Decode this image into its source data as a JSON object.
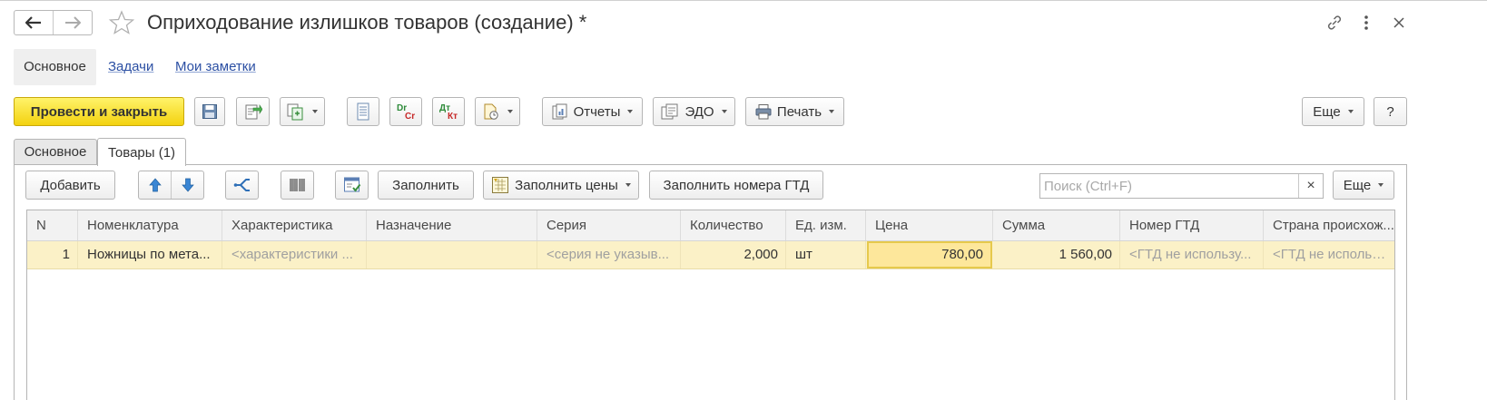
{
  "window": {
    "title": "Оприходование излишков товаров (создание) *",
    "icons": [
      "back-arrow-icon",
      "forward-arrow-icon",
      "star-icon",
      "link-icon",
      "more-vertical-icon",
      "close-icon"
    ]
  },
  "sections": {
    "main": "Основное",
    "tasks": "Задачи",
    "notes": "Мои заметки"
  },
  "toolbar": {
    "post_close": "Провести и закрыть",
    "reports": "Отчеты",
    "edo": "ЭДО",
    "print": "Печать",
    "more": "Еще",
    "help": "?",
    "icons": [
      "save-icon",
      "post-icon",
      "create-based-on-icon",
      "journal-icon",
      "dr-cr-icon",
      "dt-kt-icon",
      "attachments-icon",
      "reports-icon",
      "edo-icon",
      "printer-icon"
    ],
    "dr_top": "Dr",
    "dr_bottom": "Cr",
    "dt_top": "Дт",
    "dt_bottom": "Кт"
  },
  "tabs": {
    "main": "Основное",
    "goods": "Товары (1)"
  },
  "table_toolbar": {
    "add": "Добавить",
    "fill": "Заполнить",
    "fill_prices": "Заполнить цены",
    "fill_gtd": "Заполнить номера ГТД",
    "search_placeholder": "Поиск (Ctrl+F)",
    "clear": "×",
    "more": "Еще"
  },
  "table": {
    "columns": [
      "N",
      "Номенклатура",
      "Характеристика",
      "Назначение",
      "Серия",
      "Количество",
      "Ед. изм.",
      "Цена",
      "Сумма",
      "Номер ГТД",
      "Страна происхож..."
    ],
    "rows": [
      {
        "n": "1",
        "item": "Ножницы по мета...",
        "characteristic": "<характеристики ...",
        "purpose": "",
        "series": "<серия не указыв...",
        "quantity": "2,000",
        "unit": "шт",
        "price": "780,00",
        "sum": "1 560,00",
        "gtd": "<ГТД не использу...",
        "country": "<ГТД не использу..."
      }
    ]
  },
  "colors": {
    "primary_button": "#f3d20f",
    "selected_row": "#fbf1c7",
    "active_cell_border": "#e6c94c",
    "link": "#2b4fa3"
  }
}
